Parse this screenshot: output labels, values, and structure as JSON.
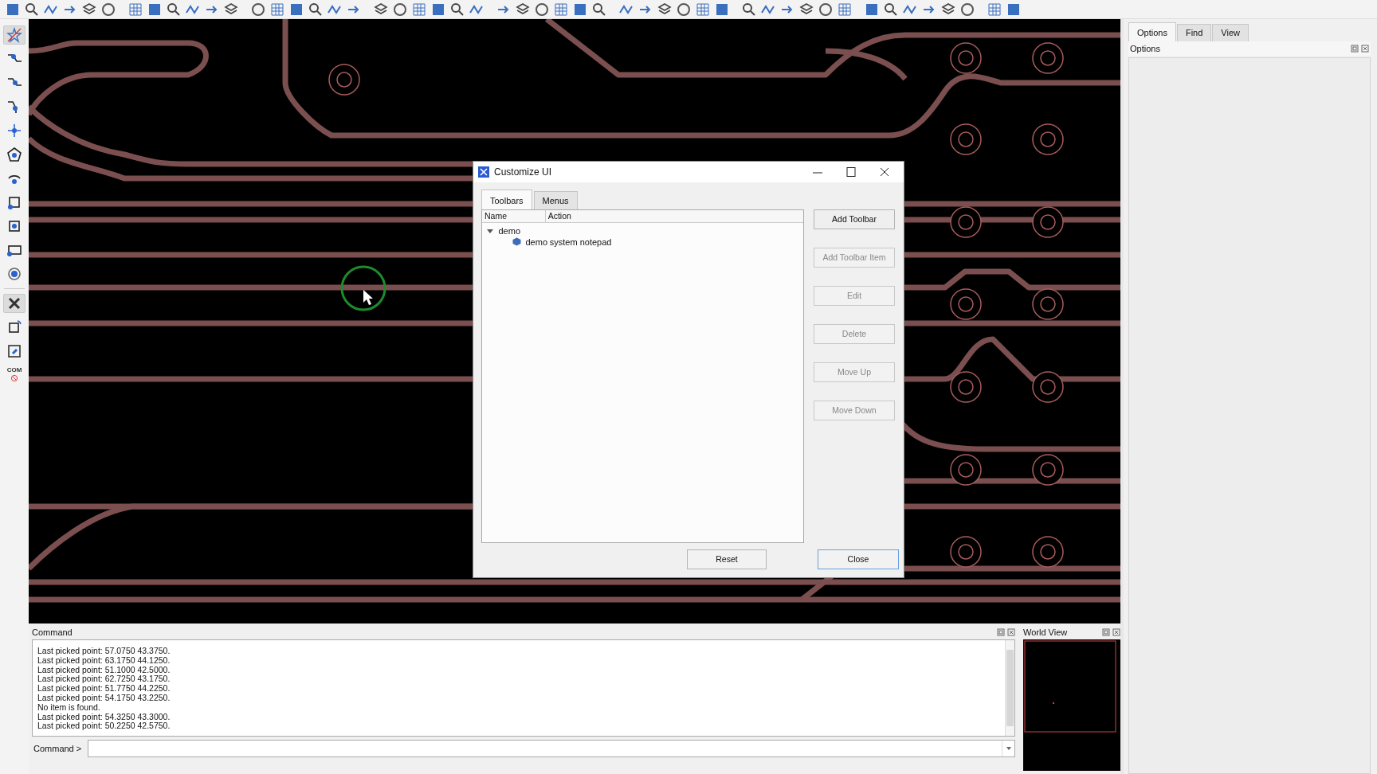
{
  "left_tools": [
    {
      "selected": true
    },
    {
      "selected": false
    },
    {
      "selected": false
    },
    {
      "selected": false
    },
    {
      "selected": false
    },
    {
      "selected": false
    },
    {
      "selected": false
    },
    {
      "selected": false
    },
    {
      "selected": false
    },
    {
      "selected": false
    },
    {
      "selected": false
    },
    {
      "selected": true
    },
    {
      "selected": false
    },
    {
      "selected": false
    },
    {
      "selected": false,
      "label": "COM"
    }
  ],
  "dialog": {
    "title": "Customize UI",
    "tabs": [
      {
        "label": "Toolbars",
        "selected": true
      },
      {
        "label": "Menus",
        "selected": false
      }
    ],
    "columns": [
      "Name",
      "Action"
    ],
    "tree": [
      {
        "name": "demo",
        "expanded": true,
        "children": [
          {
            "name": "demo",
            "action": "system notepad"
          }
        ]
      }
    ],
    "side_buttons": [
      {
        "label": "Add Toolbar",
        "disabled": false
      },
      {
        "label": "Add Toolbar Item",
        "disabled": true
      },
      {
        "label": "Edit",
        "disabled": true
      },
      {
        "label": "Delete",
        "disabled": true
      },
      {
        "label": "Move Up",
        "disabled": true
      },
      {
        "label": "Move Down",
        "disabled": true
      }
    ],
    "footer_buttons": [
      {
        "label": "Reset",
        "default": false
      },
      {
        "label": "Close",
        "default": true
      }
    ]
  },
  "right_panel": {
    "tabs": [
      {
        "label": "Options",
        "selected": true
      },
      {
        "label": "Find",
        "selected": false
      },
      {
        "label": "View",
        "selected": false
      }
    ],
    "title": "Options"
  },
  "command_panel": {
    "title": "Command",
    "log": [
      "Last picked point: 57.0750 43.3750.",
      "Last picked point: 63.1750 44.1250.",
      "Last picked point: 51.1000 42.5000.",
      "Last picked point: 62.7250 43.1750.",
      "Last picked point: 51.7750 44.2250.",
      "Last picked point: 54.1750 43.2250.",
      "No item is found.",
      "Last picked point: 54.3250 43.3000.",
      "Last picked point: 50.2250 42.5750."
    ],
    "prompt": "Command >"
  },
  "world_view": {
    "title": "World View"
  }
}
